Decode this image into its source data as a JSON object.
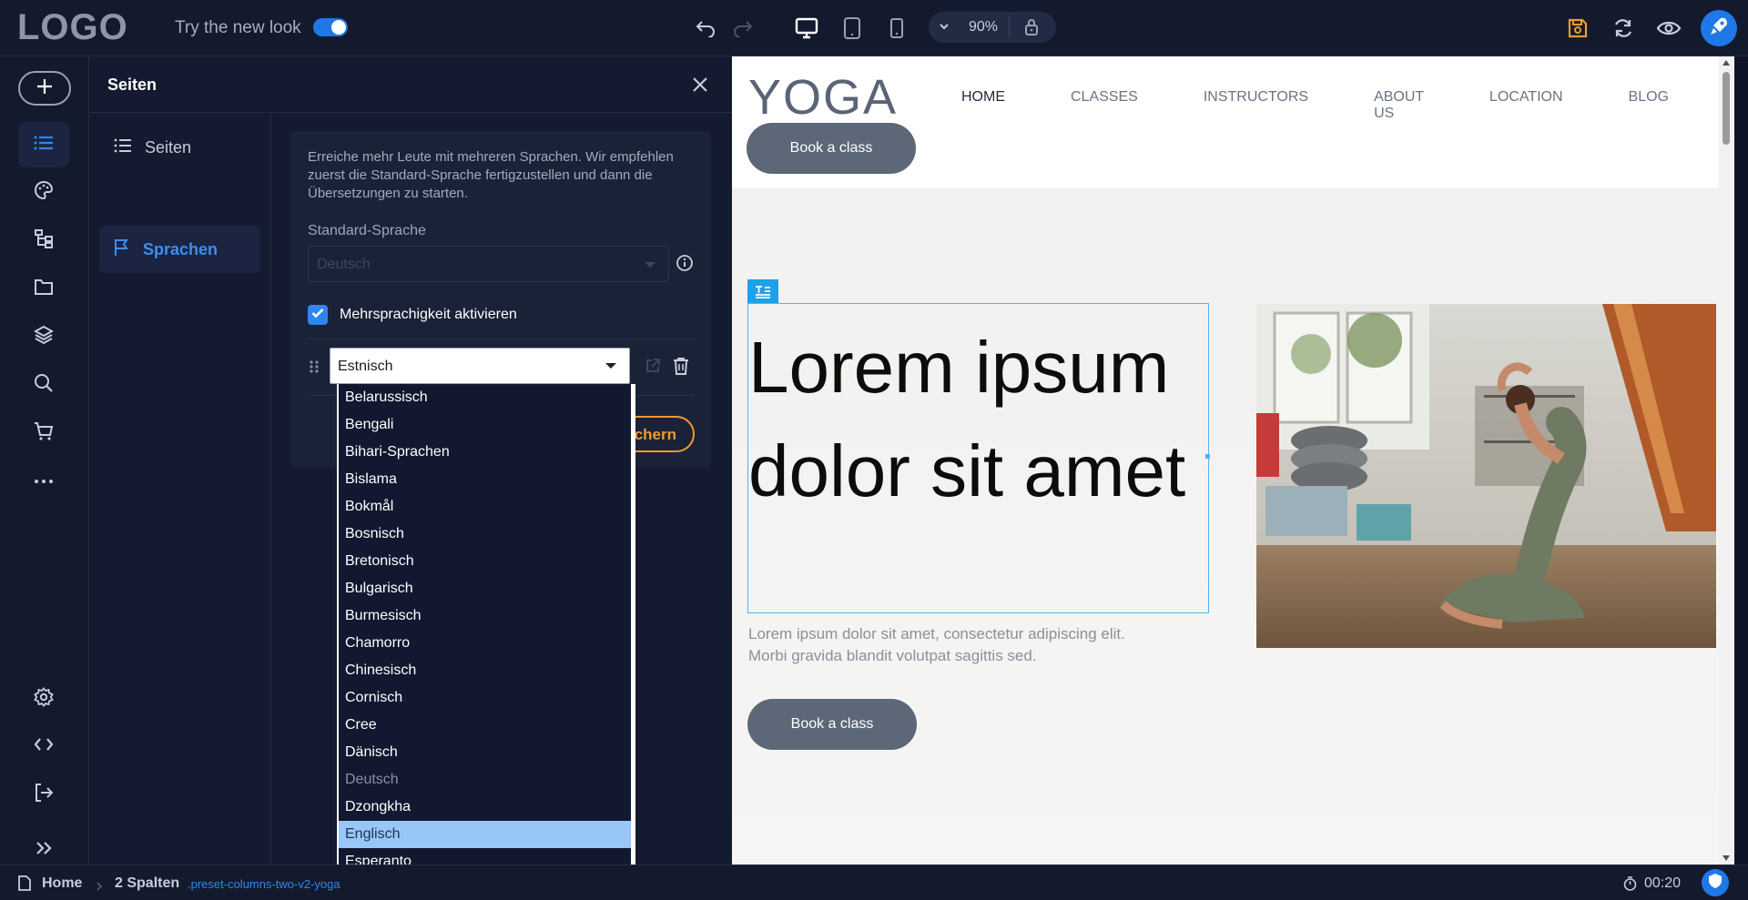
{
  "topbar": {
    "logo": "LOGO",
    "try_new_look": "Try the new look",
    "toggle_on": true,
    "zoom": "90%",
    "icons": [
      "undo-icon",
      "redo-icon",
      "desktop-icon",
      "tablet-icon",
      "mobile-icon",
      "chevron-down-icon",
      "lock-icon",
      "save-icon",
      "refresh-icon",
      "preview-eye-icon",
      "rocket-icon"
    ],
    "accent_color": "#1e78e6",
    "save_color": "#f39a2a"
  },
  "rail": {
    "icons": [
      "add-icon",
      "pages-list-icon",
      "palette-icon",
      "sitemap-icon",
      "folder-icon",
      "layers-icon",
      "search-icon",
      "cart-icon",
      "more-icon",
      "settings-icon",
      "code-icon",
      "logout-icon",
      "expand-icon"
    ]
  },
  "panel": {
    "title": "Seiten",
    "nav": [
      {
        "label": "Seiten",
        "icon": "list-icon",
        "active": false
      },
      {
        "label": "Sprachen",
        "icon": "flag-icon",
        "active": true
      }
    ],
    "intro": "Erreiche mehr Leute mit mehreren Sprachen. Wir empfehlen zuerst die Standard-Sprache fertigzustellen und dann die Übersetzungen zu starten.",
    "default_language_label": "Standard-Sprache",
    "default_language_value": "Deutsch",
    "multilang_label": "Mehrsprachigkeit aktivieren",
    "multilang_checked": true,
    "language_select_value": "Estnisch",
    "save_label_visible": "chern"
  },
  "dropdown": {
    "options": [
      "Belarussisch",
      "Bengali",
      "Bihari-Sprachen",
      "Bislama",
      "Bokmål",
      "Bosnisch",
      "Bretonisch",
      "Bulgarisch",
      "Burmesisch",
      "Chamorro",
      "Chinesisch",
      "Cornisch",
      "Cree",
      "Dänisch",
      "Deutsch",
      "Dzongkha",
      "Englisch",
      "Esperanto",
      "Estnisch"
    ],
    "disabled_option": "Deutsch",
    "highlighted_option": "Englisch"
  },
  "site": {
    "logo": "YOGA",
    "nav": [
      "HOME",
      "CLASSES",
      "INSTRUCTORS",
      "ABOUT US",
      "LOCATION",
      "BLOG"
    ],
    "active_nav": "HOME",
    "header_button": "Book a class",
    "hero_title": "Lorem ipsum dolor sit amet",
    "hero_text": "Lorem ipsum dolor sit amet, consectetur adipiscing elit. Morbi gravida blandit volutpat sagittis sed.",
    "hero_button": "Book a class"
  },
  "statusbar": {
    "crumbs": [
      "Home",
      "2 Spalten"
    ],
    "class_name": ".preset-columns-two-v2-yoga",
    "timer": "00:20"
  }
}
